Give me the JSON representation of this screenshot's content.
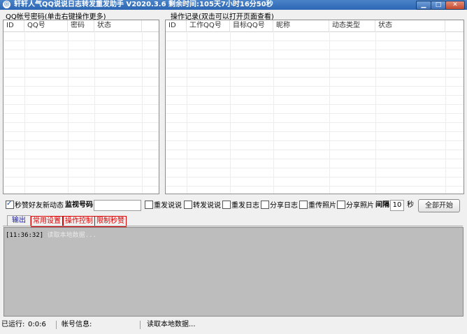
{
  "window": {
    "title": "轩轩人气QQ说说日志转发重发助手 V2020.3.6 剩余时间:105天7小时16分50秒",
    "icon_text": "◎"
  },
  "accounts_panel": {
    "title": "QQ帐号密码(单击右键操作更多)",
    "columns": [
      "ID",
      "QQ号",
      "密码",
      "状态"
    ]
  },
  "log_panel": {
    "title": "操作记录(双击可以打开页面查看)",
    "columns": [
      "ID",
      "工作QQ号",
      "目标QQ号",
      "昵称",
      "动态类型",
      "状态"
    ]
  },
  "controls": {
    "like_friends_label": "秒赞好友新动态",
    "like_friends_checked": true,
    "monitor_label": "监视号码:",
    "monitor_value": "",
    "options": [
      {
        "label": "重发说说",
        "checked": false
      },
      {
        "label": "转发说说",
        "checked": false
      },
      {
        "label": "重发日志",
        "checked": false
      },
      {
        "label": "分享日志",
        "checked": false
      },
      {
        "label": "重传照片",
        "checked": false
      },
      {
        "label": "分享照片",
        "checked": false
      }
    ],
    "interval_label": "间隔",
    "interval_value": "10",
    "interval_unit": "秒",
    "start_all_label": "全部开始"
  },
  "tabs": [
    {
      "label": "输出",
      "active": true
    },
    {
      "label": "常用设置",
      "active": false
    },
    {
      "label": "操作控制",
      "active": false
    },
    {
      "label": "限制秒赞",
      "active": false
    }
  ],
  "output": {
    "timestamp": "[11:36:32]",
    "message": "读取本地数据..."
  },
  "status": {
    "running_label": "已运行:",
    "running_value": "0:0:6",
    "account_info_label": "帐号信息:",
    "message": "读取本地数据..."
  },
  "colors": {
    "title_bar": "#2d66b3",
    "output_bg": "#bdbdbd",
    "tab_red": "#dd0000",
    "tab_active": "#1a1aa8"
  }
}
